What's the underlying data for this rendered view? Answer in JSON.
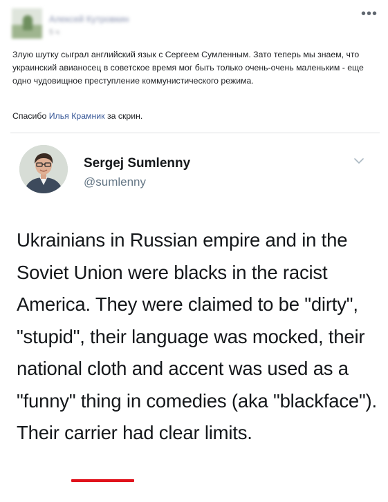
{
  "facebook_post": {
    "author_name": "Алексей Кутровкин",
    "meta": "5 ч",
    "more_label": "•••",
    "text": "Злую шутку сыграл английский язык с Сергеем Сумленным. Зато теперь мы знаем, что украинский авианосец в советское время мог быть только очень-очень маленьким - еще одно чудовищное преступление коммунистического режима.",
    "thanks_prefix": "Спасибо ",
    "thanks_link": "Илья Крамник",
    "thanks_suffix": " за скрин."
  },
  "tweet": {
    "display_name": "Sergej Sumlenny",
    "handle": "@sumlenny",
    "body_part1": "Ukrainians in Russian empire and in the Soviet Union were blacks in the racist America. They were claimed to be \"dirty\", \"stupid\", their language was mocked, their national cloth and accent was used as a \"funny\" thing in comedies (aka \"blackface\"). Their ",
    "highlighted_word": "carrier",
    "body_part2": " had clear limits."
  },
  "colors": {
    "link": "#385898",
    "highlight_underline": "#e0121b",
    "tweet_text": "#14171a",
    "handle": "#657786"
  }
}
